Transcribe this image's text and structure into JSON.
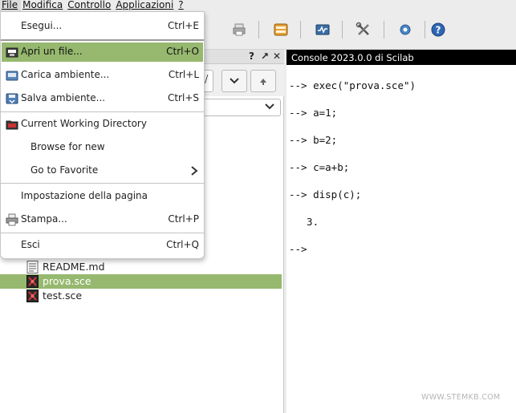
{
  "menubar": {
    "items": [
      "File",
      "Modifica",
      "Controllo",
      "Applicazioni",
      "?"
    ]
  },
  "file_menu": {
    "items": [
      {
        "label": "Esegui...",
        "shortcut": "Ctrl+E"
      },
      {
        "label": "Apri un file...",
        "shortcut": "Ctrl+O"
      },
      {
        "label": "Carica ambiente...",
        "shortcut": "Ctrl+L"
      },
      {
        "label": "Salva ambiente...",
        "shortcut": "Ctrl+S"
      },
      {
        "label": "Current Working Directory",
        "shortcut": ""
      },
      {
        "label": "Browse for new",
        "shortcut": ""
      },
      {
        "label": "Go to Favorite",
        "shortcut": ""
      },
      {
        "label": "Impostazione della pagina",
        "shortcut": ""
      },
      {
        "label": "Stampa...",
        "shortcut": "Ctrl+P"
      },
      {
        "label": "Esci",
        "shortcut": "Ctrl+Q"
      }
    ],
    "highlighted_index": 1
  },
  "file_browser": {
    "header_controls": [
      "?",
      "↗",
      "✕"
    ],
    "path_fragment": "/",
    "files": [
      {
        "name": "README.md",
        "selected": false
      },
      {
        "name": "prova.sce",
        "selected": true
      },
      {
        "name": "test.sce",
        "selected": false
      }
    ]
  },
  "console": {
    "title": "Console 2023.0.0 di Scilab",
    "lines": [
      "--> exec(\"prova.sce\")",
      "--> a=1;",
      "--> b=2;",
      "--> c=a+b;",
      "--> disp(c);",
      "  3.",
      "-->"
    ]
  },
  "watermark": "WWW.STEMKB.COM",
  "colors": {
    "highlight": "#96b86f",
    "console_header": "#000000"
  }
}
